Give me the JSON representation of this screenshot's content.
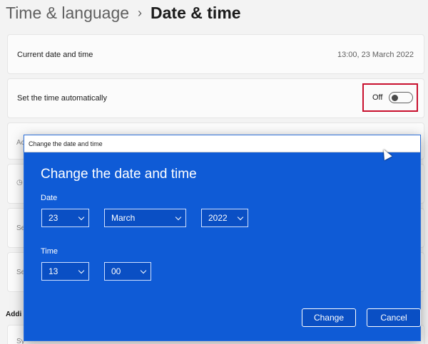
{
  "breadcrumb": {
    "parent": "Time & language",
    "separator": "›",
    "current": "Date & time"
  },
  "current_datetime": {
    "label": "Current date and time",
    "value": "13:00, 23 March 2022"
  },
  "auto_time": {
    "label": "Set the time automatically",
    "state_text": "Off",
    "enabled": false
  },
  "dialog": {
    "window_title": "Change the date and time",
    "heading": "Change the date and time",
    "date_label": "Date",
    "day": "23",
    "month": "March",
    "year": "2022",
    "time_label": "Time",
    "hour": "13",
    "minute": "00",
    "change_button": "Change",
    "cancel_button": "Cancel"
  },
  "peek": {
    "row3": "Ac",
    "row5": "Se",
    "row6": "Se",
    "section": "Addi",
    "row7": "Sy"
  },
  "colors": {
    "dialog_background": "#0f5bd6",
    "highlight_border": "#c8102e"
  },
  "icons": [
    "chevron-right-icon",
    "chevron-down-icon",
    "mouse-pointer-icon"
  ]
}
